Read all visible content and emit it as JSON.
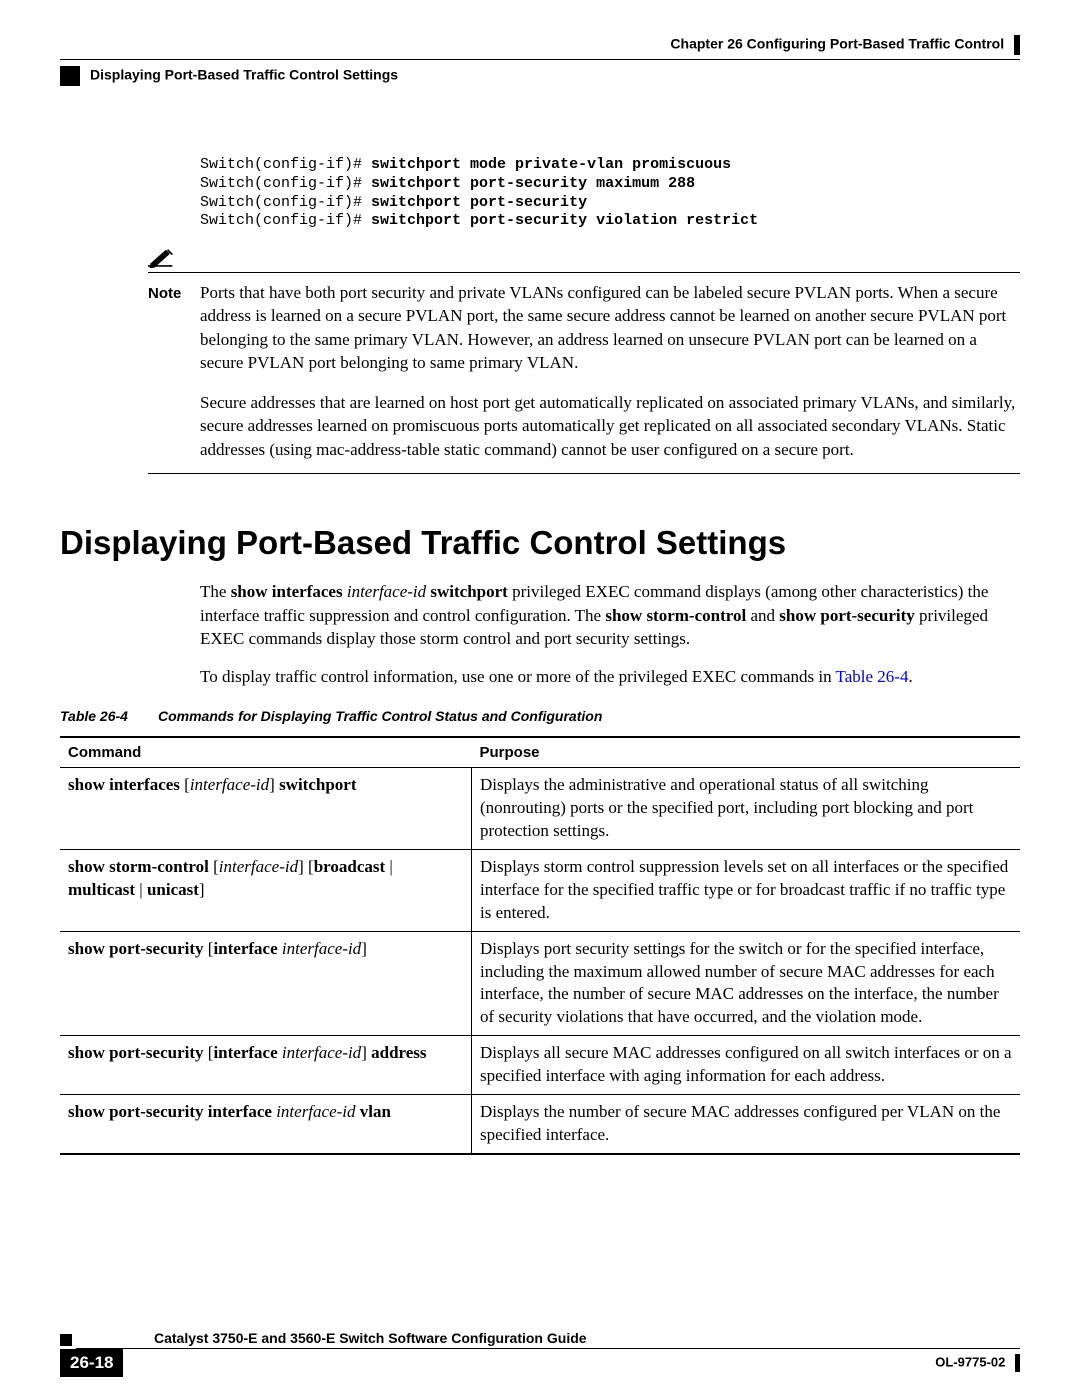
{
  "header": {
    "chapter": "Chapter 26      Configuring Port-Based Traffic Control",
    "section": "Displaying Port-Based Traffic Control Settings"
  },
  "cli": {
    "prompt": "Switch(config-if)# ",
    "lines": [
      "switchport mode private-vlan promiscuous",
      "switchport port-security maximum 288",
      "switchport port-security",
      "switchport port-security violation restrict"
    ]
  },
  "note": {
    "label": "Note",
    "p1": "Ports that have both port security and private VLANs configured can be labeled secure PVLAN ports. When a secure address is learned on a secure PVLAN port, the same secure address cannot be learned on another secure PVLAN port belonging to the same primary VLAN. However, an address learned on unsecure PVLAN port can be learned on a secure PVLAN port belonging to same primary VLAN.",
    "p2": "Secure addresses that are learned on host port get automatically replicated on associated primary VLANs, and similarly, secure addresses learned on promiscuous ports automatically get replicated on all associated secondary VLANs. Static addresses (using mac-address-table static command) cannot be user configured on a secure port."
  },
  "h1": "Displaying Port-Based Traffic Control Settings",
  "intro": {
    "p1_a": "The ",
    "p1_b": "show interfaces",
    "p1_c": " interface-id ",
    "p1_d": "switchport",
    "p1_e": " privileged EXEC command displays (among other characteristics) the interface traffic suppression and control configuration. The ",
    "p1_f": "show storm-control",
    "p1_g": " and ",
    "p1_h": "show port-security",
    "p1_i": " privileged EXEC commands display those storm control and port security settings.",
    "p2_a": "To display traffic control information, use one or more of the privileged EXEC commands in ",
    "p2_link": "Table 26-4",
    "p2_b": "."
  },
  "table": {
    "caption_num": "Table 26-4",
    "caption_text": "Commands for Displaying Traffic Control Status and Configuration",
    "head_cmd": "Command",
    "head_purpose": "Purpose",
    "rows": [
      {
        "cmd_parts": [
          "<b>show interfaces</b> [<i>interface-id</i>] <b>switchport</b>"
        ],
        "purpose": "Displays the administrative and operational status of all switching (nonrouting) ports or the specified port, including port blocking and port protection settings."
      },
      {
        "cmd_parts": [
          "<b>show storm-control</b> [<i>interface-id</i>] [<b>broadcast</b> | <b>multicast</b> | <b>unicast</b>]"
        ],
        "purpose": "Displays storm control suppression levels set on all interfaces or the specified interface for the specified traffic type or for broadcast traffic if no traffic type is entered."
      },
      {
        "cmd_parts": [
          "<b>show port-security</b> [<b>interface</b> <i>interface-id</i>]"
        ],
        "purpose": "Displays port security settings for the switch or for the specified interface, including the maximum allowed number of secure MAC addresses for each interface, the number of secure MAC addresses on the interface, the number of security violations that have occurred, and the violation mode."
      },
      {
        "cmd_parts": [
          "<b>show port-security</b> [<b>interface</b> <i>interface-id</i>] <b>address</b>"
        ],
        "purpose": "Displays all secure MAC addresses configured on all switch interfaces or on a specified interface with aging information for each address."
      },
      {
        "cmd_parts": [
          "<b>show port-security interface</b> <i>interface-id</i> <b>vlan</b>"
        ],
        "purpose": "Displays the number of secure MAC addresses configured per VLAN on the specified interface."
      }
    ]
  },
  "footer": {
    "guide": "Catalyst 3750-E and 3560-E Switch Software Configuration Guide",
    "page": "26-18",
    "docid": "OL-9775-02"
  }
}
